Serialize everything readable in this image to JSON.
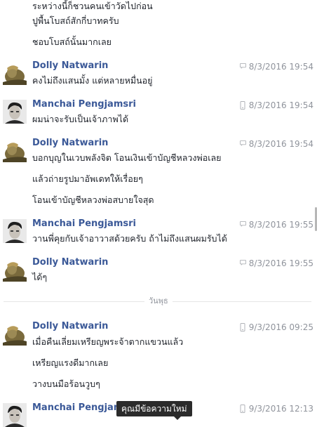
{
  "top_messages": [
    "ระหว่างนี้ก็ชวนคนเข้าวัดไปก่อน",
    "ปูพื้นโบสถ์สักกี่บาทครับ",
    "ชอบโบสถ์นั้นมากเลย"
  ],
  "groups": [
    {
      "sender": "Dolly Natwarin",
      "time": "8/3/2016 19:54",
      "icon": "chat-icon",
      "messages": [
        "คงไม่ถึงแสนมั้ง แต่หลายหมื่นอยู่"
      ]
    },
    {
      "sender": "Manchai Pengjamsri",
      "time": "8/3/2016 19:54",
      "icon": "mobile-icon",
      "messages": [
        "ผมน่าจะรับเป็นเจ้าภาพได้"
      ]
    },
    {
      "sender": "Dolly Natwarin",
      "time": "8/3/2016 19:54",
      "icon": "chat-icon",
      "messages": [
        "บอกบุญในเวบพลังจิต โอนเงินเข้าบัญชีหลวงพ่อเลย",
        "แล้วถ่ายรูปมาอัพเดทให้เรื่อยๆ",
        "โอนเข้าบัญชีหลวงพ่อสบายใจสุด"
      ]
    },
    {
      "sender": "Manchai Pengjamsri",
      "time": "8/3/2016 19:55",
      "icon": "chat-icon",
      "messages": [
        "วานพี่คุยกับเจ้าอาวาสด้วยครับ ถ้าไม่ถึงแสนผมรับได้"
      ]
    },
    {
      "sender": "Dolly Natwarin",
      "time": "8/3/2016 19:55",
      "icon": "chat-icon",
      "messages": [
        "ได้ๆ"
      ]
    },
    {
      "sender": "Dolly Natwarin",
      "time": "9/3/2016 09:25",
      "icon": "mobile-icon",
      "messages": [
        "เมื่อคืนเลี่ยมเหรียญพระจ้าตากแขวนแล้ว",
        "เหรียญแรงดีมากเลย",
        "วางบนมือร้อนวูบๆ"
      ]
    },
    {
      "sender": "Manchai Pengjam",
      "time": "9/3/2016 12:13",
      "icon": "mobile-icon",
      "messages": []
    }
  ],
  "day_divider": "วันพุธ",
  "tooltip": "คุณมีข้อความใหม่",
  "colors": {
    "sender": "#3b5998",
    "timestamp": "#90949c",
    "text": "#1d2129"
  }
}
